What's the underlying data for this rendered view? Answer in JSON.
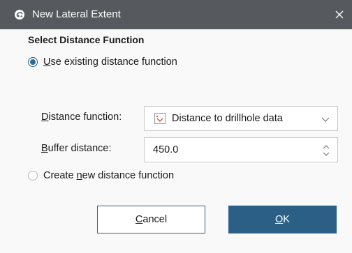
{
  "window": {
    "title": "New Lateral Extent",
    "icon": "app-logo-icon",
    "close_icon": "close-icon"
  },
  "section": {
    "title": "Select Distance Function"
  },
  "options": {
    "use_existing": {
      "mnemonic": "U",
      "rest": "se existing distance function",
      "selected": true
    },
    "create_new": {
      "prefix": "Create ",
      "mnemonic": "n",
      "rest": "ew distance function",
      "selected": false
    }
  },
  "fields": {
    "distance_function": {
      "label_mnemonic": "D",
      "label_rest": "istance function:",
      "value": "Distance to drillhole data",
      "value_icon": "distance-function-icon"
    },
    "buffer_distance": {
      "label_mnemonic": "B",
      "label_rest": "uffer distance:",
      "value": "450.0"
    }
  },
  "buttons": {
    "cancel": {
      "mnemonic": "C",
      "rest": "ancel"
    },
    "ok": {
      "mnemonic": "O",
      "rest": "K"
    }
  },
  "colors": {
    "titlebar": "#565a5f",
    "accent": "#2c5f86"
  }
}
